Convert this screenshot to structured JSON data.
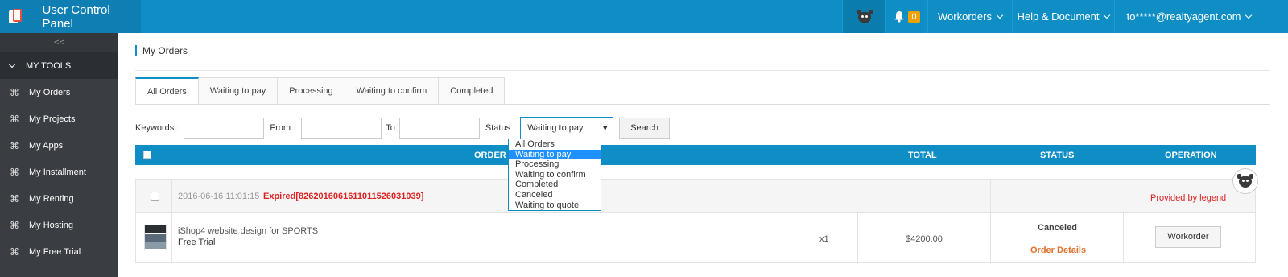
{
  "app": {
    "title": "User Control Panel"
  },
  "topbar": {
    "notification_count": "0",
    "workorders_label": "Workorders",
    "help_label": "Help & Document",
    "account_label": "to*****@realtyagent.com"
  },
  "sidebar": {
    "collapse_label": "<<",
    "section_label": "MY TOOLS",
    "items": [
      {
        "label": "My Orders"
      },
      {
        "label": "My Projects"
      },
      {
        "label": "My Apps"
      },
      {
        "label": "My Installment"
      },
      {
        "label": "My Renting"
      },
      {
        "label": "My Hosting"
      },
      {
        "label": "My Free Trial"
      }
    ]
  },
  "page": {
    "title": "My Orders"
  },
  "tabs": [
    {
      "label": "All Orders",
      "active": true
    },
    {
      "label": "Waiting to pay"
    },
    {
      "label": "Processing"
    },
    {
      "label": "Waiting to confirm"
    },
    {
      "label": "Completed"
    }
  ],
  "filters": {
    "keywords_label": "Keywords :",
    "keywords_value": "",
    "from_label": "From :",
    "from_value": "",
    "to_label": "To:",
    "to_value": "",
    "status_label": "Status :",
    "status_value": "Waiting to pay",
    "status_options": [
      "All Orders",
      "Waiting to pay",
      "Processing",
      "Waiting to confirm",
      "Completed",
      "Canceled",
      "Waiting to quote"
    ],
    "search_label": "Search"
  },
  "table": {
    "headers": {
      "order": "ORDER I",
      "total": "TOTAL",
      "status": "STATUS",
      "operation": "OPERATION"
    }
  },
  "order": {
    "date": "2016-06-16 11:01:15",
    "expired": "Expired[826201606161101152603103​9]",
    "provided_by": "Provided by legend",
    "product_name": "iShop4 website design for SPORTS",
    "product_sub": "Free Trial",
    "quantity": "x1",
    "total": "$4200.00",
    "status": "Canceled",
    "details_label": "Order Details",
    "workorder_label": "Workorder"
  },
  "colors": {
    "brand": "#0e8ec4",
    "sidebar": "#3a3d42",
    "expired": "#e02020",
    "details": "#e0702a"
  }
}
